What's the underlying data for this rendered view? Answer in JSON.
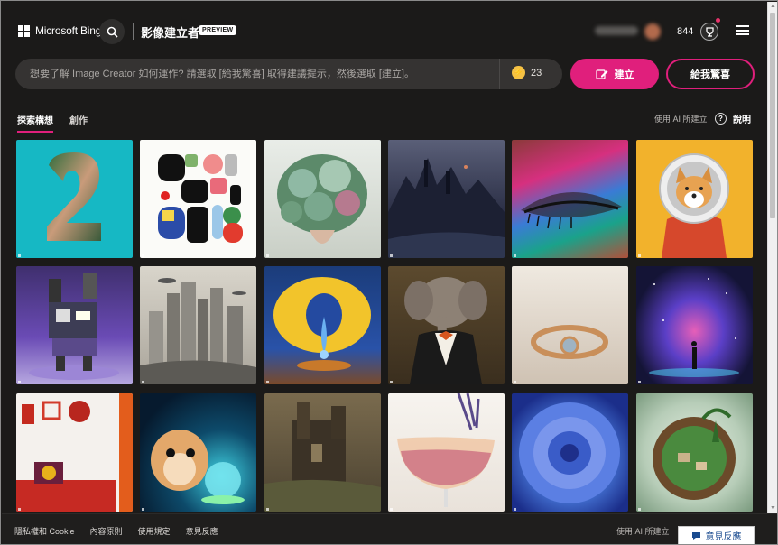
{
  "header": {
    "brand": "Microsoft Bing",
    "product_title": "影像建立者",
    "preview_badge": "PREVIEW",
    "points": "844"
  },
  "prompt": {
    "placeholder": "想要了解 Image Creator 如何運作? 請選取 [給我驚喜] 取得建議提示，然後選取 [建立]。",
    "boost_count": "23",
    "create_label": "建立",
    "surprise_label": "給我驚喜"
  },
  "tabs": [
    {
      "label": "探索構想",
      "active": true
    },
    {
      "label": "創作",
      "active": false
    }
  ],
  "ai_used_label": "使用 AI 所建立",
  "help_label": "說明",
  "gallery": {
    "tile_count": 18,
    "columns": 6,
    "tiles": [
      "number-2-collage",
      "colorful-abstract-shapes",
      "succulent-bouquet",
      "dark-fantasy-castle",
      "rainbow-eyeshadow-eye",
      "shiba-astronaut",
      "purple-robot",
      "futuristic-city-ruins",
      "lemon-surreal-drop",
      "elephant-in-tuxedo",
      "gold-ring",
      "galaxy-silhouette",
      "red-interior-room",
      "hamster-crystal-ball",
      "castle-ruins-painting",
      "cocktail-glass",
      "blue-dahlia-flower",
      "tiny-world-island"
    ]
  },
  "footer": {
    "links": [
      "隱私權和 Cookie",
      "內容原則",
      "使用規定",
      "意見反應"
    ],
    "ai_note": "使用 AI 所建立",
    "feedback_button": "意見反應"
  },
  "colors": {
    "accent": "#e01f7c",
    "background": "#1b1a19",
    "prompt_bg": "#353332"
  }
}
